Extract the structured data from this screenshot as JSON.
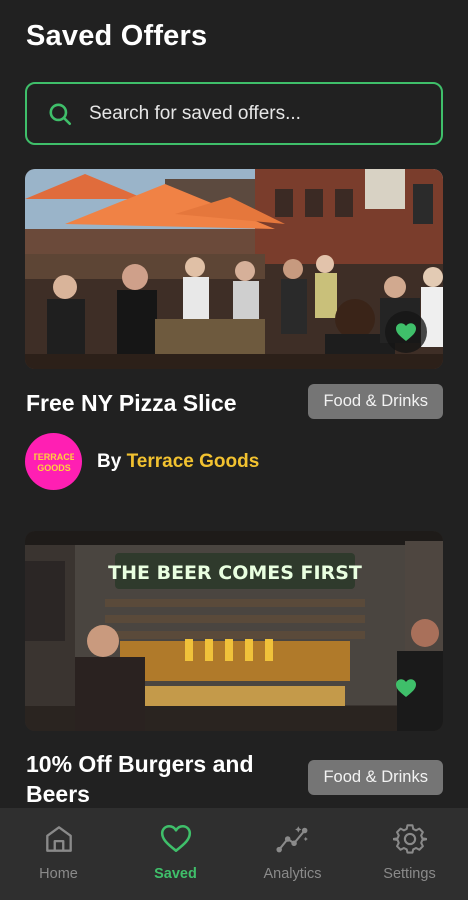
{
  "header": {
    "title": "Saved Offers"
  },
  "search": {
    "placeholder": "Search for saved offers..."
  },
  "colors": {
    "accent_green": "#3fbf6a",
    "merchant_name": "#f2c230",
    "badge_bg": "#757575",
    "background": "#212121",
    "nav_bg": "#2f2f2f"
  },
  "offers": [
    {
      "title": "Free NY Pizza Slice",
      "category": "Food & Drinks",
      "merchant_by": "By",
      "merchant_name": "Terrace Goods",
      "merchant_logo_text": "TERRACE GOODS",
      "saved": true,
      "image_icon": "outdoor-terrace-photo"
    },
    {
      "title": "10% Off Burgers and Beers",
      "category": "Food & Drinks",
      "saved": true,
      "image_icon": "bar-counter-photo",
      "image_sign_text": "THE BEER COMES FIRST"
    }
  ],
  "bottom_nav": {
    "items": [
      {
        "label": "Home",
        "icon": "home-icon",
        "active": false
      },
      {
        "label": "Saved",
        "icon": "heart-icon",
        "active": true
      },
      {
        "label": "Analytics",
        "icon": "analytics-icon",
        "active": false
      },
      {
        "label": "Settings",
        "icon": "gear-icon",
        "active": false
      }
    ]
  }
}
